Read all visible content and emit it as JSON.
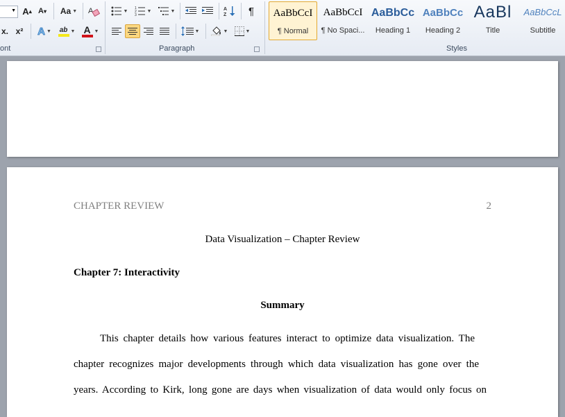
{
  "ribbon": {
    "font_size_value": "",
    "font_group_label": "ont",
    "paragraph_group_label": "Paragraph",
    "styles_group_label": "Styles",
    "grow_font": "A",
    "shrink_font": "A",
    "change_case": "Aa",
    "strike": "x.",
    "superscript": "x²",
    "text_effects": "A",
    "highlight": "ab",
    "font_color": "A",
    "highlight_color": "#f5e81a",
    "font_color_value": "#d0131a",
    "show_marks": "¶"
  },
  "styles": [
    {
      "sample": "AaBbCcI",
      "name": "¶ Normal",
      "color": "#000000",
      "selected": true
    },
    {
      "sample": "AaBbCcI",
      "name": "¶ No Spaci...",
      "color": "#000000",
      "selected": false
    },
    {
      "sample": "AaBbCc",
      "name": "Heading 1",
      "color": "#2a5c9a",
      "selected": false
    },
    {
      "sample": "AaBbCc",
      "name": "Heading 2",
      "color": "#4f81bd",
      "selected": false
    },
    {
      "sample": "AaBl",
      "name": "Title",
      "color": "#17365d",
      "selected": false
    },
    {
      "sample": "AaBbCcL",
      "name": "Subtitle",
      "color": "#4f81bd",
      "selected": false
    }
  ],
  "document": {
    "header_title": "CHAPTER REVIEW",
    "page_number": "2",
    "title": "Data Visualization – Chapter Review",
    "chapter_heading": "Chapter 7: Interactivity",
    "section_heading": "Summary",
    "paragraph_lines": [
      "This chapter details how various features interact to optimize data visualization. The",
      "chapter recognizes major developments through which data visualization has gone over the",
      "years. According to Kirk, long gone are days when visualization of data would only focus on"
    ]
  }
}
